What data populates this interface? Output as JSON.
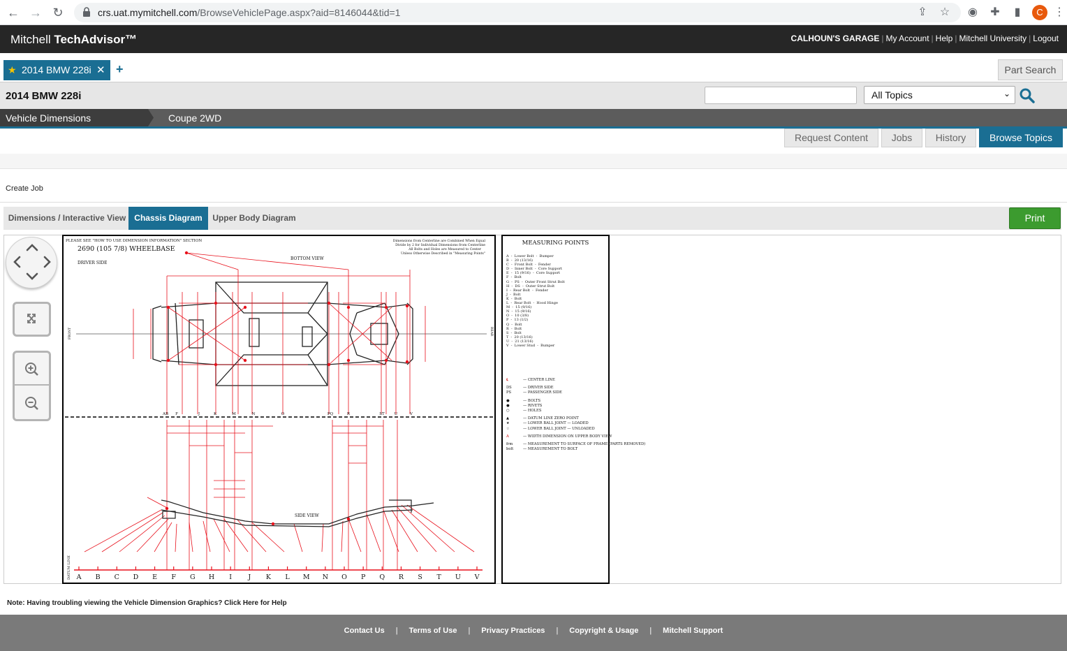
{
  "browser": {
    "url_host": "crs.uat.mymitchell.com",
    "url_path": "/BrowseVehiclePage.aspx?aid=8146044&tid=1",
    "profile_initial": "C"
  },
  "header": {
    "brand_light": "Mitchell ",
    "brand_bold": "TechAdvisor™",
    "garage": "CALHOUN'S GARAGE",
    "links": [
      "My Account",
      "Help",
      "Mitchell University",
      "Logout"
    ]
  },
  "tabs": {
    "vehicle_tab": "2014 BMW 228i",
    "part_search": "Part Search"
  },
  "vehicle_bar": {
    "vehicle_name": "2014 BMW 228i",
    "search_value": "",
    "topic_selected": "All Topics"
  },
  "breadcrumb": [
    "Vehicle Dimensions",
    "Coupe 2WD"
  ],
  "action_tabs": [
    "Request Content",
    "Jobs",
    "History",
    "Browse Topics"
  ],
  "create_job": "Create Job",
  "dimension_tabs": [
    "Dimensions / Interactive View",
    "Chassis Diagram",
    "Upper Body Diagram"
  ],
  "print_label": "Print",
  "diagram": {
    "note_top": "PLEASE SEE \"HOW TO USE DIMENSION INFORMATION\" SECTION",
    "wheelbase": "2690 (105 7/8) WHEELBASE",
    "driver_side": "DRIVER SIDE",
    "bottom_view": "BOTTOM VIEW",
    "side_view": "SIDE VIEW",
    "front": "FRONT",
    "rear": "REAR",
    "datum": "DATUM LINE",
    "centerline_note": [
      "Dimensions from Centerline are Combined When Equal",
      "Divide by 2 for Individual Dimensions from Centerline",
      "All Bolts and Holes are Measured to Center",
      "Unless Otherwise Described in \"Measuring Points\""
    ],
    "letters": [
      "A",
      "B",
      "C",
      "D",
      "E",
      "F",
      "G",
      "H",
      "I",
      "J",
      "K",
      "L",
      "M",
      "N",
      "O",
      "P",
      "Q",
      "R",
      "S",
      "T",
      "U",
      "V"
    ],
    "top_letters": [
      "AB",
      "F",
      "J",
      "K",
      "M",
      "N",
      "O",
      "PQ",
      "R",
      "ST",
      "U",
      "V"
    ]
  },
  "legend": {
    "title": "MEASURING POINTS",
    "points": "A  -  Lower Bolt  -  Bumper\nB  -  20 (13/16)\nC  -  Front Bolt  -  Fender\nD  -  Inner Bolt  -  Core Support\nE  -  15 (9/16)  -  Core Support\nF  -  Bolt\nG  -  PS  -  Outer Front Strut Bolt\nH  -  DS  -  Outer Strut Bolt\nI  -  Rear Bolt  -  Fender\nJ  -  Bolt\nK  -  Bolt\nL  -  Rear Bolt  -  Hood Hinge\nM  -  15 (9/16)\nN  -  15 (9/16)\nO  -  10 (3/8)\nP  -  13 (1/2)\nQ  -  Bolt\nR  -  Bolt\nS  -  Bolt\nT  -  20 (13/16)\nU  -  21 (13/16)\nV  -  Lower Stud  -  Bumper",
    "symbols": [
      {
        "sym": "℄",
        "text": "—  CENTER  LINE"
      },
      {
        "sym": "DS",
        "text": "—  DRIVER  SIDE"
      },
      {
        "sym": "PS",
        "text": "—  PASSENGER  SIDE"
      },
      {
        "sym": "●",
        "text": "—  BOLTS"
      },
      {
        "sym": "●",
        "text": "—  RIVETS"
      },
      {
        "sym": "○",
        "text": "—  HOLES"
      },
      {
        "sym": "▲",
        "text": "—  DATUM  LINE  ZERO  POINT"
      },
      {
        "sym": "★",
        "text": "—  LOWER  BALL  JOINT  —  LOADED"
      },
      {
        "sym": "☆",
        "text": "—  LOWER  BALL  JOINT  —  UNLOADED"
      },
      {
        "sym": "A",
        "text": "—  WIDTH  DIMENSION  ON  UPPER  BODY  VIEW"
      },
      {
        "sym": "frm",
        "text": "—  MEASUREMENT  TO  SURFACE  OF  FRAME  (PARTS  REMOVED)"
      },
      {
        "sym": "bolt",
        "text": "—  MEASUREMENT  TO  BOLT"
      }
    ]
  },
  "note": {
    "text": "Note: Having troubling viewing the Vehicle Dimension Graphics? ",
    "link": "Click Here for Help"
  },
  "footer": [
    "Contact Us",
    "Terms of Use",
    "Privacy Practices",
    "Copyright & Usage",
    "Mitchell Support"
  ],
  "colors": {
    "brand_blue": "#1a6e93",
    "print_green": "#3c9b2f",
    "diagram_red": "#e8101b"
  }
}
